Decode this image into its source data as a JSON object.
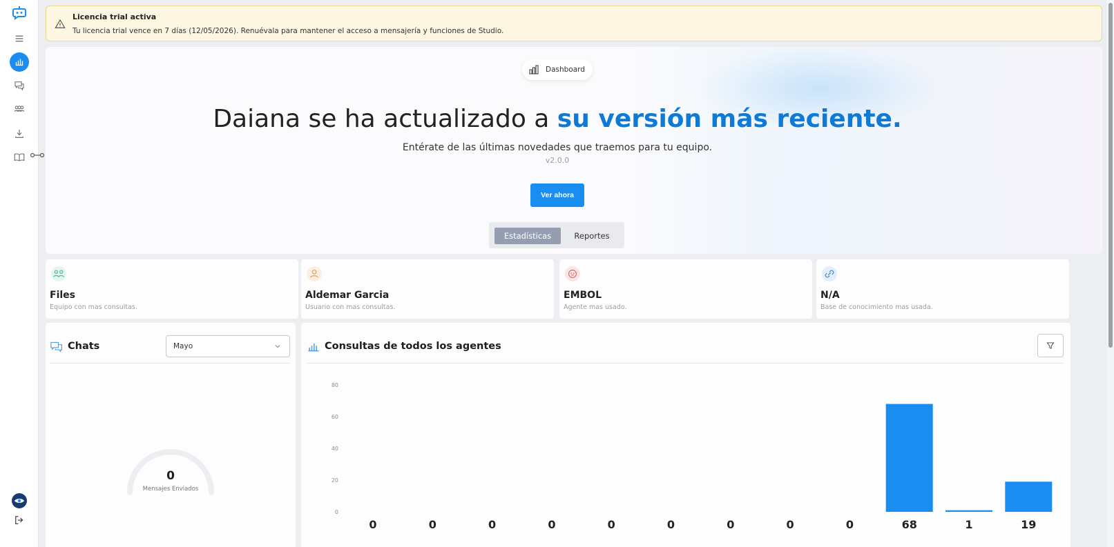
{
  "banner": {
    "title": "Licencia trial activa",
    "text": "Tu licencia trial vence en 7 días (12/05/2026). Renuévala para mantener el acceso a mensajería y funciones de Studio."
  },
  "hero": {
    "pill_label": "Dashboard",
    "title_prefix": "Daiana se ha actualizado a ",
    "title_highlight": "su versión más reciente.",
    "subtitle": "Entérate de las últimas novedades que traemos para tu equipo.",
    "version": "v2.0.0",
    "cta_label": "Ver ahora",
    "tabs": [
      "Estadísticas",
      "Reportes"
    ]
  },
  "stats": [
    {
      "title": "Files",
      "desc": "Equipo con mas consultas.",
      "icon": "team-icon"
    },
    {
      "title": "Aldemar Garcia",
      "desc": "Usuario con mas consultas.",
      "icon": "user-icon"
    },
    {
      "title": "EMBOL",
      "desc": "Agente mas usado.",
      "icon": "agent-icon"
    },
    {
      "title": "N/A",
      "desc": "Base de conocimiento mas usada.",
      "icon": "link-icon"
    }
  ],
  "chats": {
    "title": "Chats",
    "month": "Mayo",
    "gauge_value": "0",
    "gauge_label": "Mensajes Enviados"
  },
  "consultas": {
    "title": "Consultas de todos los agentes"
  },
  "colors": {
    "accent": "#1a8df0",
    "highlight": "#0f7ad6",
    "banner_bg": "#fdf7e1"
  },
  "chart_data": {
    "type": "bar",
    "ylim": [
      0,
      80
    ],
    "yticks": [
      "0",
      "20",
      "40",
      "60",
      "80"
    ],
    "values": [
      0,
      0,
      0,
      0,
      0,
      0,
      0,
      0,
      0,
      68,
      1,
      19
    ],
    "value_labels": [
      "0",
      "0",
      "0",
      "0",
      "0",
      "0",
      "0",
      "0",
      "0",
      "68",
      "1",
      "19"
    ],
    "bar_color": "#1a8df0"
  }
}
